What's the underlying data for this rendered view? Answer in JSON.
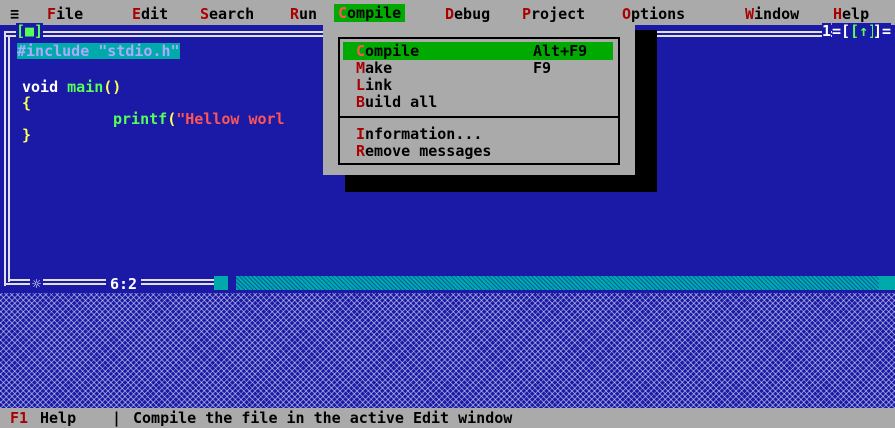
{
  "menubar": {
    "system_icon": "≡",
    "items": [
      {
        "hot": "F",
        "rest": "ile"
      },
      {
        "hot": "E",
        "rest": "dit"
      },
      {
        "hot": "S",
        "rest": "earch"
      },
      {
        "hot": "R",
        "rest": "un"
      },
      {
        "hot": "C",
        "rest": "ompile"
      },
      {
        "hot": "D",
        "rest": "ebug"
      },
      {
        "hot": "P",
        "rest": "roject"
      },
      {
        "hot": "O",
        "rest": "ptions"
      },
      {
        "hot": "W",
        "rest": "indow"
      },
      {
        "hot": "H",
        "rest": "elp"
      }
    ]
  },
  "editor": {
    "close_box": "[■]",
    "window_number": "1",
    "resize_box": "[↑]",
    "zoom_box_left": "=[",
    "zoom_box_right": "]=",
    "modified_marker": "☼",
    "cursor_position": "6:2",
    "code": {
      "line1": "#include \"stdio.h\"",
      "line3_kw": "void",
      "line3_fn": "main",
      "line3_paren": "()",
      "line4": "{",
      "line5_fn": "printf",
      "line5_paren": "(",
      "line5_str": "\"Hellow worl",
      "line6": "}"
    }
  },
  "compile_menu": {
    "items": [
      {
        "hot": "C",
        "rest": "ompile",
        "shortcut": "Alt+F9",
        "selected": true
      },
      {
        "hot": "M",
        "rest": "ake",
        "shortcut": "F9"
      },
      {
        "hot": "L",
        "rest": "ink",
        "shortcut": ""
      },
      {
        "hot": "B",
        "rest": "uild all",
        "shortcut": ""
      },
      {
        "hot": "I",
        "rest": "nformation...",
        "shortcut": ""
      },
      {
        "hot": "R",
        "rest": "emove messages",
        "shortcut": ""
      }
    ]
  },
  "statusbar": {
    "key": "F1",
    "key_label": "Help",
    "separator": "|",
    "message": "Compile the file in the active Edit window"
  },
  "colors": {
    "desktop_blue": "#1a1aa6",
    "menu_gray": "#aaaaaa",
    "highlight_green": "#00aa00",
    "hotkey_red": "#aa0000",
    "include_cyan": "#00aaaa",
    "function_green": "#55ff55",
    "brace_yellow": "#ffff55",
    "string_red": "#ff5555"
  }
}
